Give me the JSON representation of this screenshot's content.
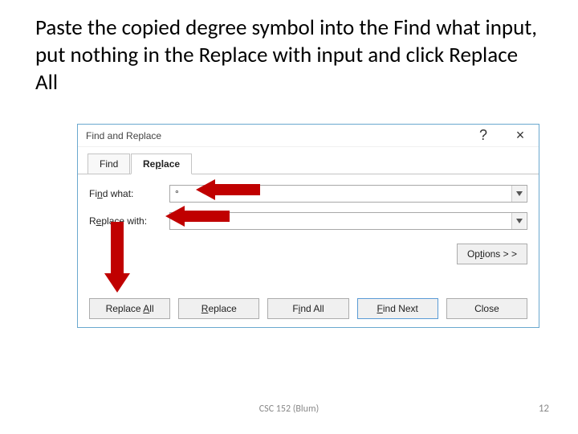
{
  "heading": "Paste the copied degree symbol into the Find what input, put nothing in the Replace with input and click Replace All",
  "dialog": {
    "title": "Find and Replace",
    "help": "?",
    "close": "×",
    "tabs": {
      "find": "Find",
      "replace_pre": "Re",
      "replace_alt": "p",
      "replace_post": "lace"
    },
    "find_what": {
      "label_pre": "Fi",
      "label_alt": "n",
      "label_post": "d what:",
      "value": "°"
    },
    "replace_with": {
      "label_pre": "R",
      "label_alt": "e",
      "label_post": "place with:",
      "value": ""
    },
    "options": {
      "pre": "Op",
      "alt": "t",
      "post": "ions > >"
    },
    "buttons": {
      "replace_all": {
        "pre": "Replace ",
        "alt": "A",
        "post": "ll"
      },
      "replace": {
        "pre": "",
        "alt": "R",
        "post": "eplace"
      },
      "find_all": {
        "pre": "F",
        "alt": "i",
        "post": "nd All"
      },
      "find_next": {
        "pre": "",
        "alt": "F",
        "post": "ind Next"
      },
      "close": {
        "pre": "Close",
        "alt": "",
        "post": ""
      }
    }
  },
  "footer": {
    "course": "CSC 152 (Blum)",
    "page": "12"
  }
}
